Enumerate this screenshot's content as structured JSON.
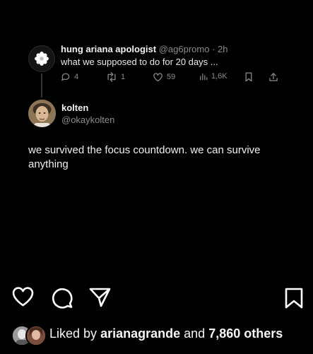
{
  "tweet_card": {
    "reply": {
      "name": "hung ariana apologist",
      "handle": "@ag6promo",
      "separator": "·",
      "time": "2h",
      "text": "what we supposed to do for 20 days ...",
      "counts": {
        "replies": "4",
        "retweets": "1",
        "likes": "59",
        "views": "1,6K"
      }
    },
    "main": {
      "name": "kolten",
      "handle": "@okaykolten",
      "text": "we survived the focus countdown. we can survive anything"
    }
  },
  "footer": {
    "liked_prefix": "Liked by",
    "liked_user": "ariana‍grande",
    "liked_and": "and",
    "liked_others": "7,860 others"
  },
  "icons": [
    "heart-icon",
    "comment-icon",
    "share-icon",
    "bookmark-icon"
  ]
}
